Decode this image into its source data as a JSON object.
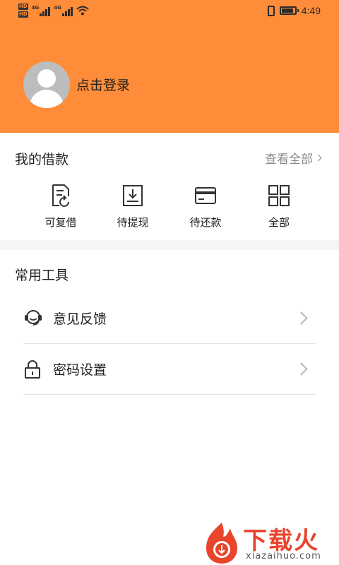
{
  "status_bar": {
    "hd1": "HD",
    "hd2": "HD",
    "net1": "4G",
    "net2": "4G",
    "time": "4:49"
  },
  "profile": {
    "login_label": "点击登录"
  },
  "loans": {
    "title": "我的借款",
    "view_all": "查看全部",
    "items": [
      {
        "label": "可复借",
        "icon": "document-refresh-icon"
      },
      {
        "label": "待提现",
        "icon": "download-tray-icon"
      },
      {
        "label": "待还款",
        "icon": "card-icon"
      },
      {
        "label": "全部",
        "icon": "grid-icon"
      }
    ]
  },
  "tools": {
    "title": "常用工具",
    "items": [
      {
        "label": "意见反馈",
        "icon": "headset-icon"
      },
      {
        "label": "密码设置",
        "icon": "lock-icon"
      }
    ]
  },
  "watermark": {
    "brand": "下载火",
    "site": "xiazaihuo.com"
  },
  "colors": {
    "header": "#ff8c38",
    "watermark": "#e8452c"
  }
}
